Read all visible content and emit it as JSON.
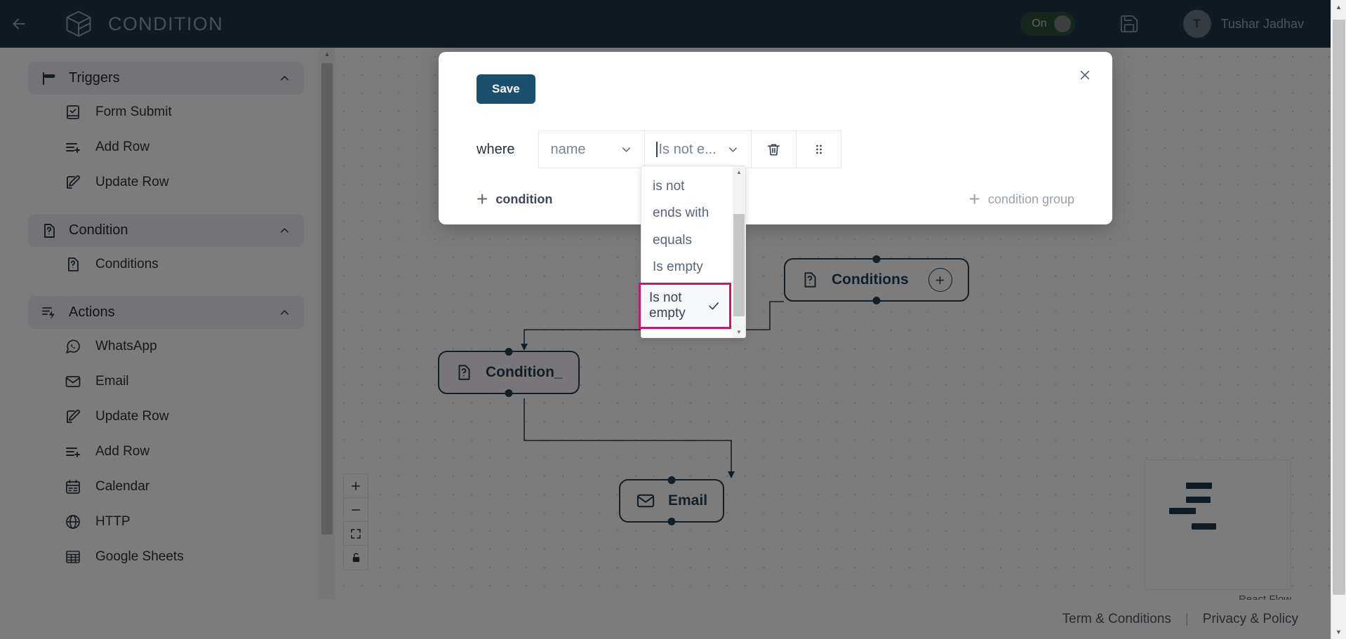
{
  "header": {
    "back_icon": "arrow-left-icon",
    "logo_icon": "cube-logo-icon",
    "title": "CONDITION",
    "toggle_label": "On",
    "toggle_state": "on",
    "save_icon": "floppy-disk-icon",
    "avatar_initial": "T",
    "user_name": "Tushar Jadhav",
    "background_color": "#0b2132",
    "toggle_color": "#114021"
  },
  "sidebar": {
    "groups": [
      {
        "title": "Triggers",
        "icon": "flag-icon",
        "chevron": "chevron-up-icon",
        "items": [
          {
            "label": "Form Submit",
            "icon": "form-check-icon"
          },
          {
            "label": "Add Row",
            "icon": "add-row-icon"
          },
          {
            "label": "Update Row",
            "icon": "edit-pencil-icon"
          }
        ]
      },
      {
        "title": "Condition",
        "icon": "question-doc-icon",
        "chevron": "chevron-up-icon",
        "items": [
          {
            "label": "Conditions",
            "icon": "question-doc-icon"
          }
        ]
      },
      {
        "title": "Actions",
        "icon": "action-bolt-icon",
        "chevron": "chevron-up-icon",
        "items": [
          {
            "label": "WhatsApp",
            "icon": "whatsapp-icon"
          },
          {
            "label": "Email",
            "icon": "envelope-icon"
          },
          {
            "label": "Update Row",
            "icon": "edit-pencil-icon"
          },
          {
            "label": "Add Row",
            "icon": "add-row-icon"
          },
          {
            "label": "Calendar",
            "icon": "calendar-icon"
          },
          {
            "label": "HTTP",
            "icon": "globe-icon"
          },
          {
            "label": "Google Sheets",
            "icon": "table-grid-icon"
          }
        ]
      }
    ]
  },
  "canvas": {
    "nodes": [
      {
        "id": "conditions",
        "label": "Conditions",
        "icon": "question-doc-icon",
        "has_plus": true,
        "plus_icon": "plus-icon"
      },
      {
        "id": "condition_1",
        "label": "Condition_",
        "icon": "question-doc-icon",
        "has_plus": false
      },
      {
        "id": "email",
        "label": "Email",
        "icon": "envelope-icon",
        "has_plus": false
      }
    ],
    "zoom_controls": [
      {
        "name": "zoom-in",
        "icon": "plus-icon"
      },
      {
        "name": "zoom-out",
        "icon": "minus-icon"
      },
      {
        "name": "fit-view",
        "icon": "fit-view-icon"
      },
      {
        "name": "toggle-interactivity",
        "icon": "lock-icon"
      }
    ],
    "attribution": "React Flow",
    "node_border_color": "#14293c"
  },
  "modal": {
    "close_icon": "close-icon",
    "save_label": "Save",
    "save_color": "#1b4f6e",
    "where_label": "where",
    "field_value": "name",
    "field_chevron": "chevron-down-icon",
    "operator_value": "Is not e...",
    "operator_chevron": "chevron-down-icon",
    "delete_icon": "trash-icon",
    "drag_icon": "drag-handle-icon",
    "add_condition_label": "condition",
    "add_condition_plus": "plus-icon",
    "add_condition_group_label": "condition group",
    "add_condition_group_plus": "plus-icon"
  },
  "dropdown": {
    "highlight_color": "#c2186f",
    "check_icon": "check-icon",
    "scroll_up_icon": "triangle-up-icon",
    "scroll_down_icon": "triangle-down-icon",
    "options": [
      {
        "label": "is not",
        "selected": false
      },
      {
        "label": "ends with",
        "selected": false
      },
      {
        "label": "equals",
        "selected": false
      },
      {
        "label": "Is empty",
        "selected": false
      },
      {
        "label": "Is not empty",
        "selected": true
      }
    ]
  },
  "footer": {
    "terms_label": "Term & Conditions",
    "separator": "|",
    "privacy_label": "Privacy & Policy"
  }
}
